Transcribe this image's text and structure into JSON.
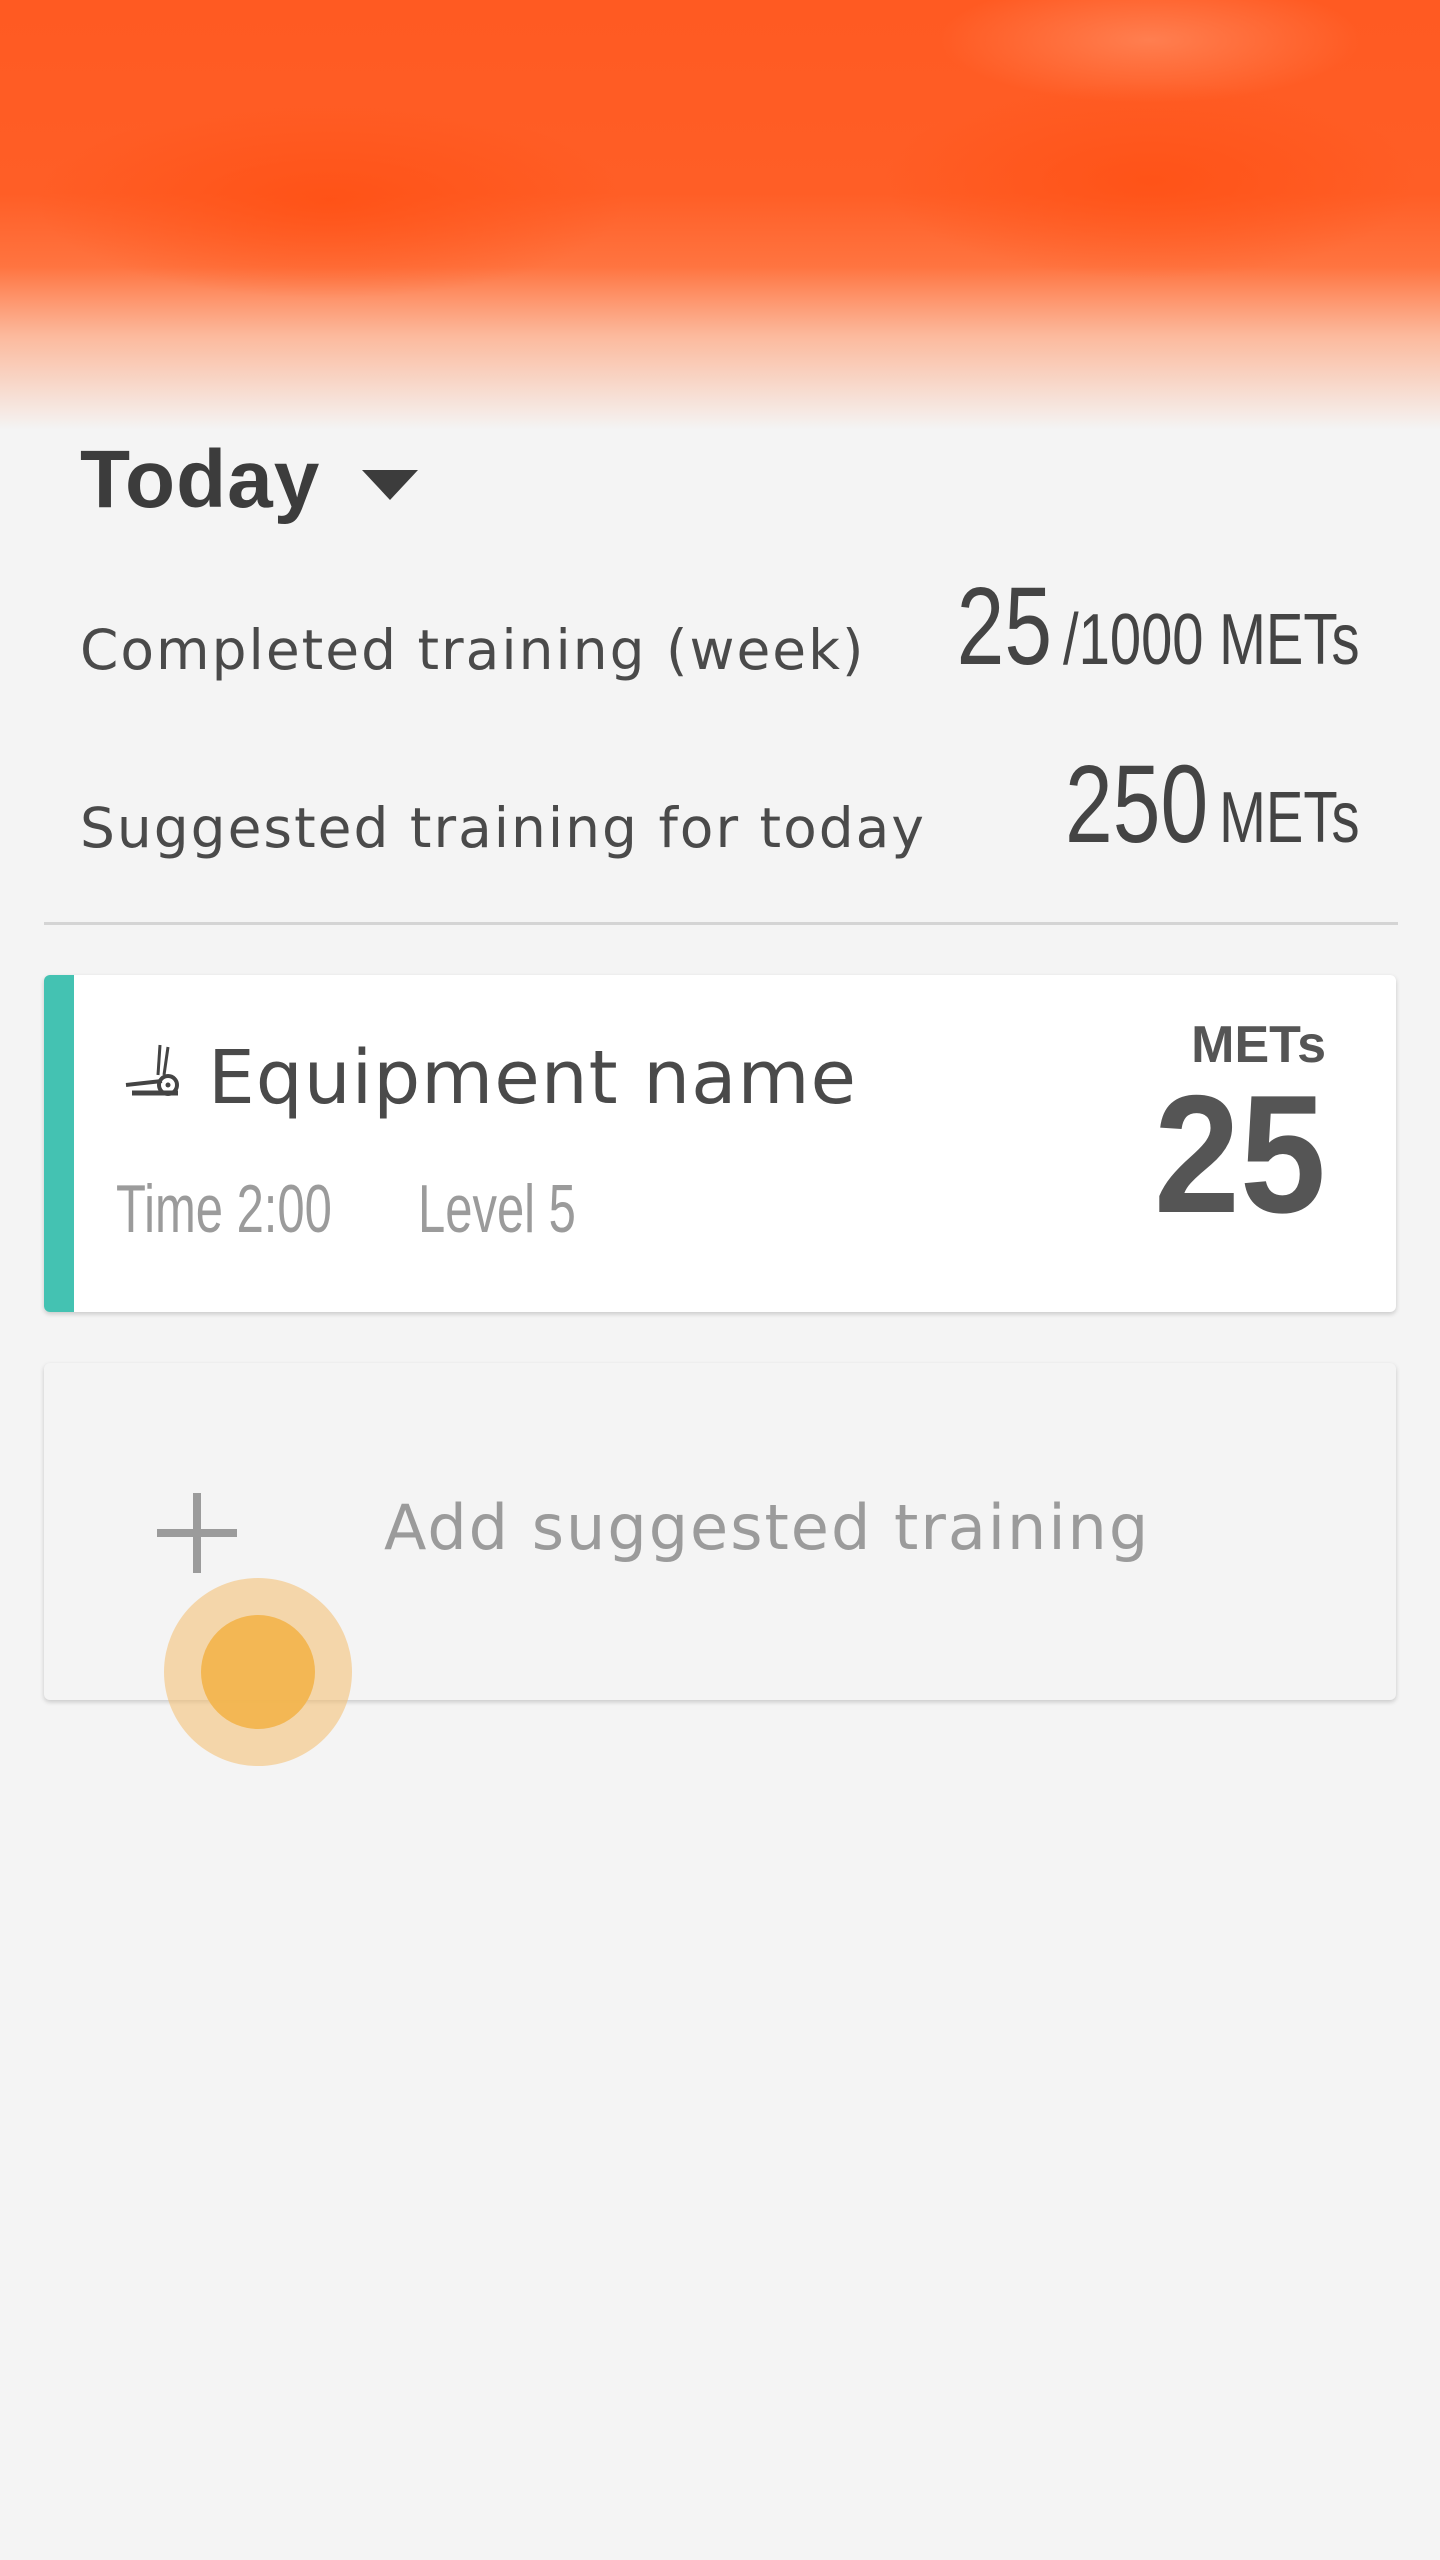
{
  "period_selector": {
    "label": "Today"
  },
  "stats": {
    "completed": {
      "label": "Completed training (week)",
      "value": "25",
      "suffix": "/1000 METs"
    },
    "suggested": {
      "label": "Suggested training for today",
      "value": "250",
      "suffix": "METs"
    }
  },
  "workout_card": {
    "accent_color": "#44c2b2",
    "icon": "elliptical-trainer-icon",
    "equipment_name": "Equipment name",
    "time": "Time 2:00",
    "level": "Level 5",
    "mets_caption": "METs",
    "mets_value": "25"
  },
  "add_card": {
    "icon": "plus-icon",
    "label": "Add suggested training"
  },
  "colors": {
    "header_orange": "#ff5a22",
    "touch_indicator": "#f2b54f"
  }
}
